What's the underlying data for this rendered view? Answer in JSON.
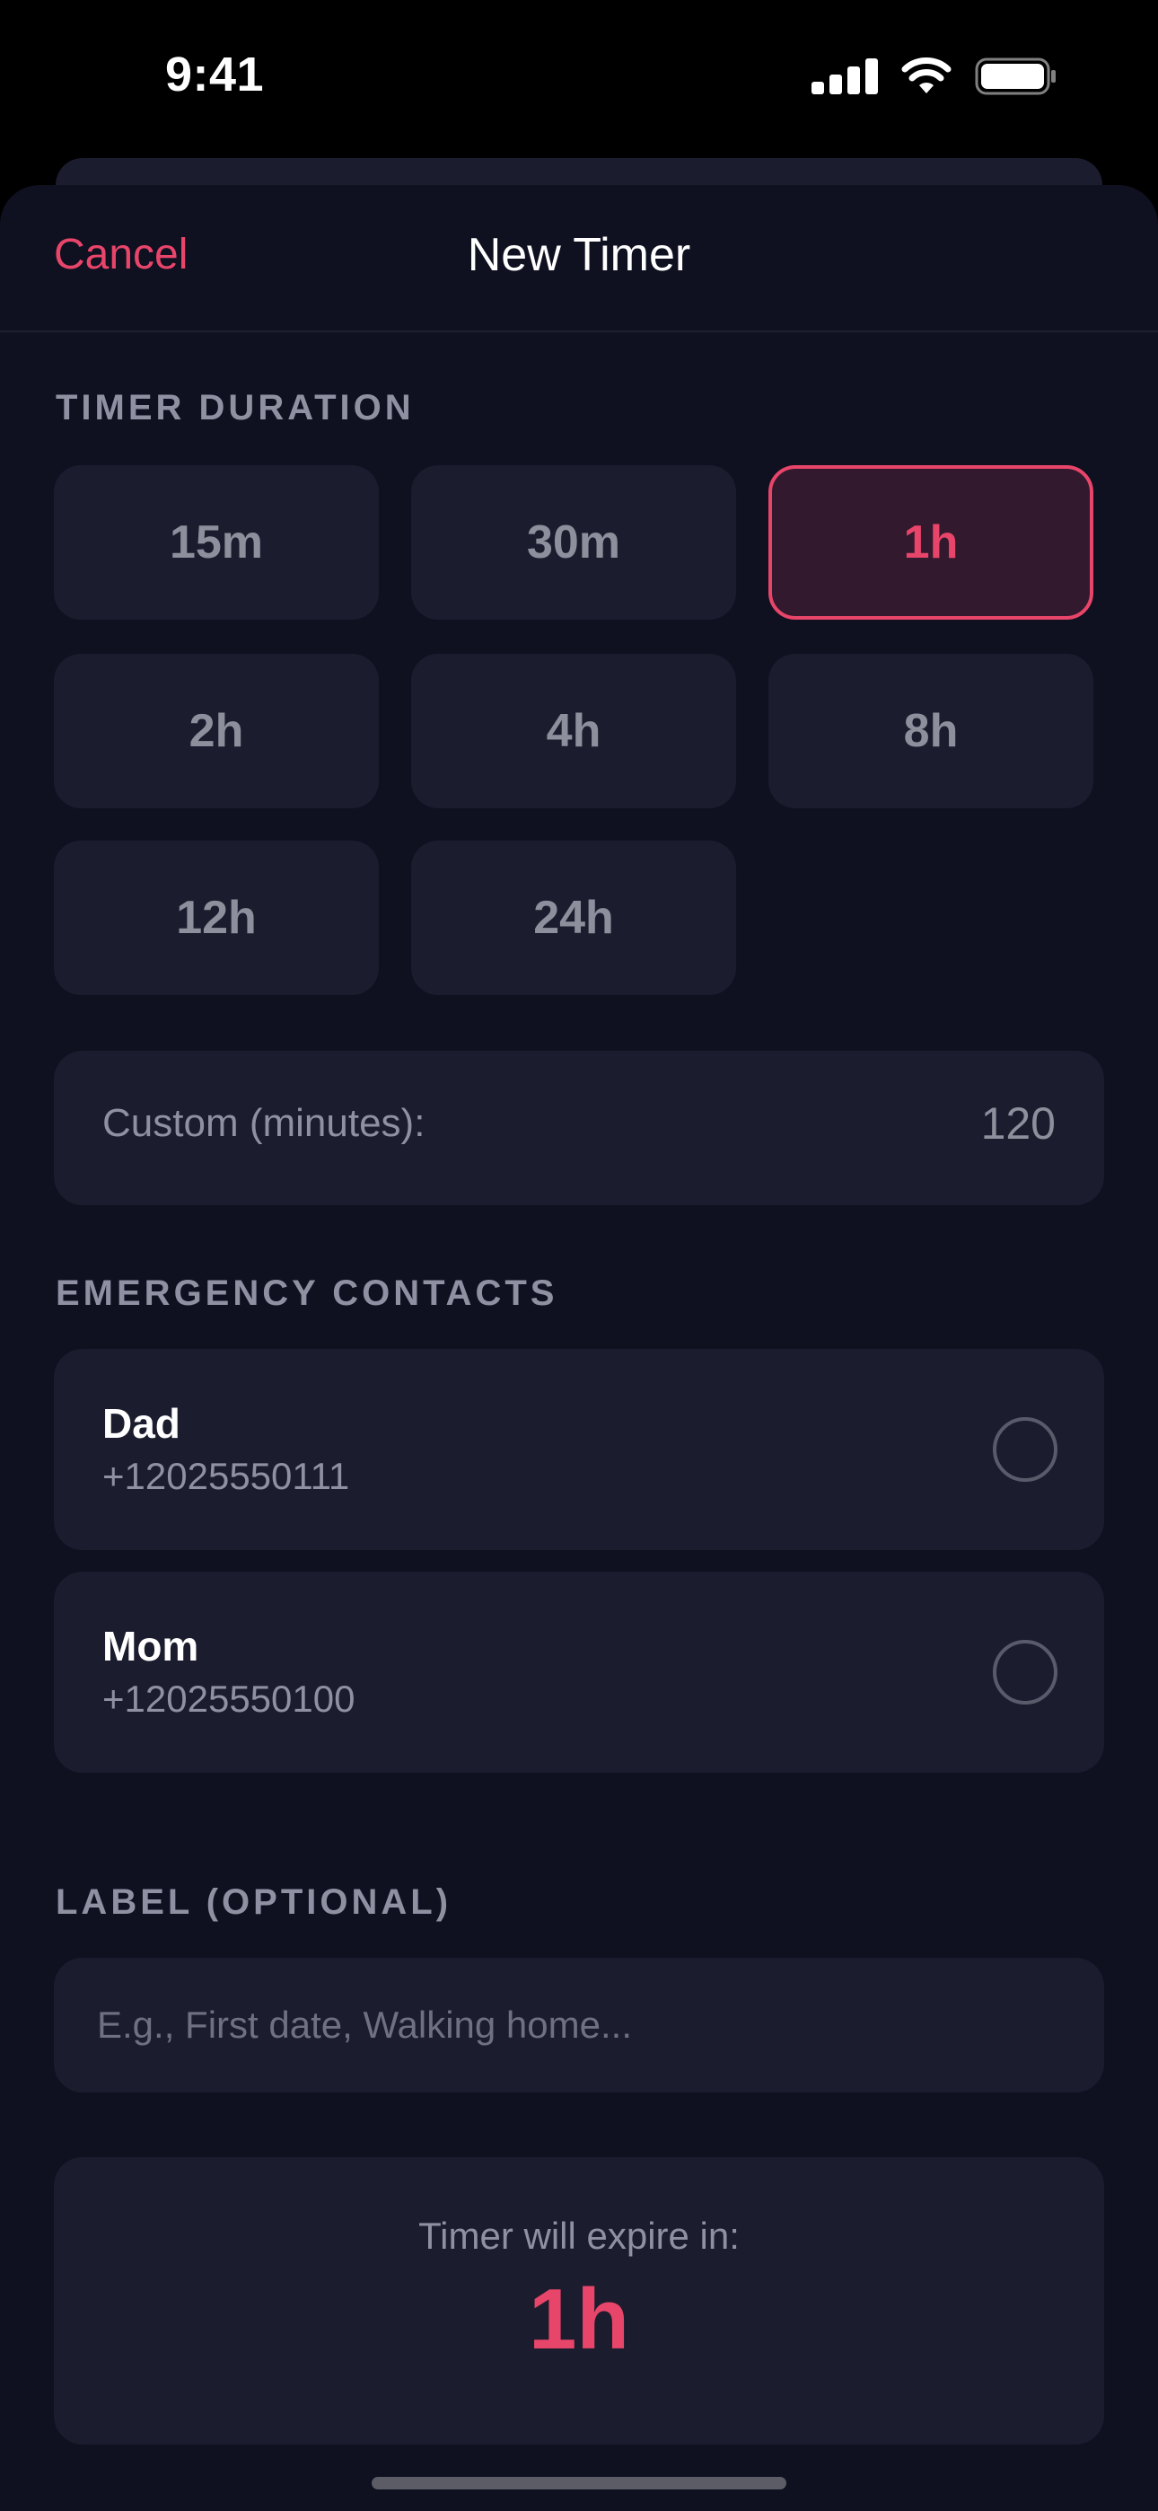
{
  "status_bar": {
    "time": "9:41"
  },
  "nav": {
    "cancel_label": "Cancel",
    "title": "New Timer"
  },
  "duration": {
    "section_label": "TIMER DURATION",
    "options": [
      "15m",
      "30m",
      "1h",
      "2h",
      "4h",
      "8h",
      "12h",
      "24h"
    ],
    "selected": "1h"
  },
  "custom": {
    "label": "Custom (minutes):",
    "value": "120"
  },
  "contacts": {
    "section_label": "EMERGENCY CONTACTS",
    "items": [
      {
        "name": "Dad",
        "phone": "+12025550111"
      },
      {
        "name": "Mom",
        "phone": "+12025550100"
      }
    ]
  },
  "label_field": {
    "section_label": "LABEL (OPTIONAL)",
    "placeholder": "E.g., First date, Walking home..."
  },
  "expire": {
    "caption": "Timer will expire in:",
    "value": "1h"
  },
  "colors": {
    "accent": "#e8456a",
    "sheet_bg": "#0f1020",
    "card_bg": "#1b1c2e"
  }
}
